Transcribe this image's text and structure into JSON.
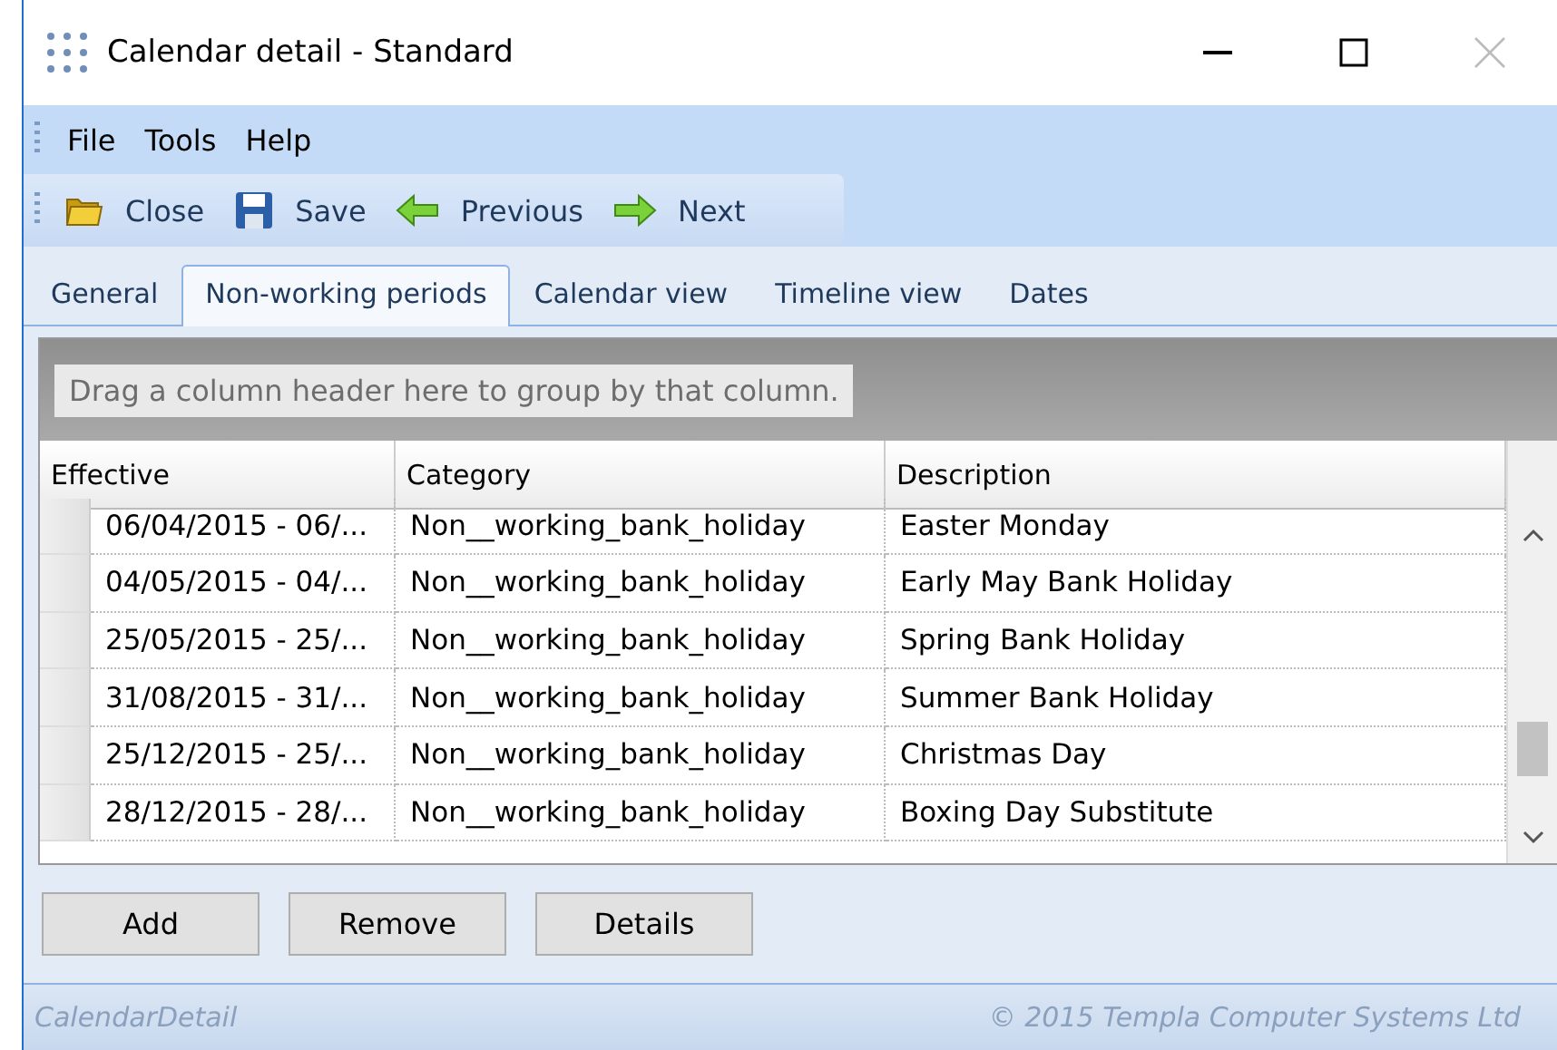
{
  "window": {
    "title": "Calendar detail - Standard"
  },
  "menu": [
    "File",
    "Tools",
    "Help"
  ],
  "toolbar": [
    {
      "kind": "close",
      "label": "Close"
    },
    {
      "kind": "save",
      "label": "Save"
    },
    {
      "kind": "previous",
      "label": "Previous"
    },
    {
      "kind": "next",
      "label": "Next"
    }
  ],
  "tabs": [
    {
      "label": "General",
      "selected": false
    },
    {
      "label": "Non-working periods",
      "selected": true
    },
    {
      "label": "Calendar view",
      "selected": false
    },
    {
      "label": "Timeline view",
      "selected": false
    },
    {
      "label": "Dates",
      "selected": false
    }
  ],
  "group_panel": {
    "hint": "Drag a column header here to group by that column."
  },
  "table": {
    "columns": [
      "Effective",
      "Category",
      "Description"
    ],
    "rows": [
      [
        "06/04/2015 - 06/...",
        "Non__working_bank_holiday",
        "Easter Monday"
      ],
      [
        "04/05/2015 - 04/...",
        "Non__working_bank_holiday",
        "Early May Bank Holiday"
      ],
      [
        "25/05/2015 - 25/...",
        "Non__working_bank_holiday",
        "Spring Bank Holiday"
      ],
      [
        "31/08/2015 - 31/...",
        "Non__working_bank_holiday",
        "Summer Bank Holiday"
      ],
      [
        "25/12/2015 - 25/...",
        "Non__working_bank_holiday",
        "Christmas Day"
      ],
      [
        "28/12/2015 - 28/...",
        "Non__working_bank_holiday",
        "Boxing Day Substitute"
      ]
    ]
  },
  "buttons": [
    "Add",
    "Remove",
    "Details"
  ],
  "status_bar": {
    "left": "CalendarDetail",
    "right": "© 2015 Templa Computer Systems Ltd"
  }
}
